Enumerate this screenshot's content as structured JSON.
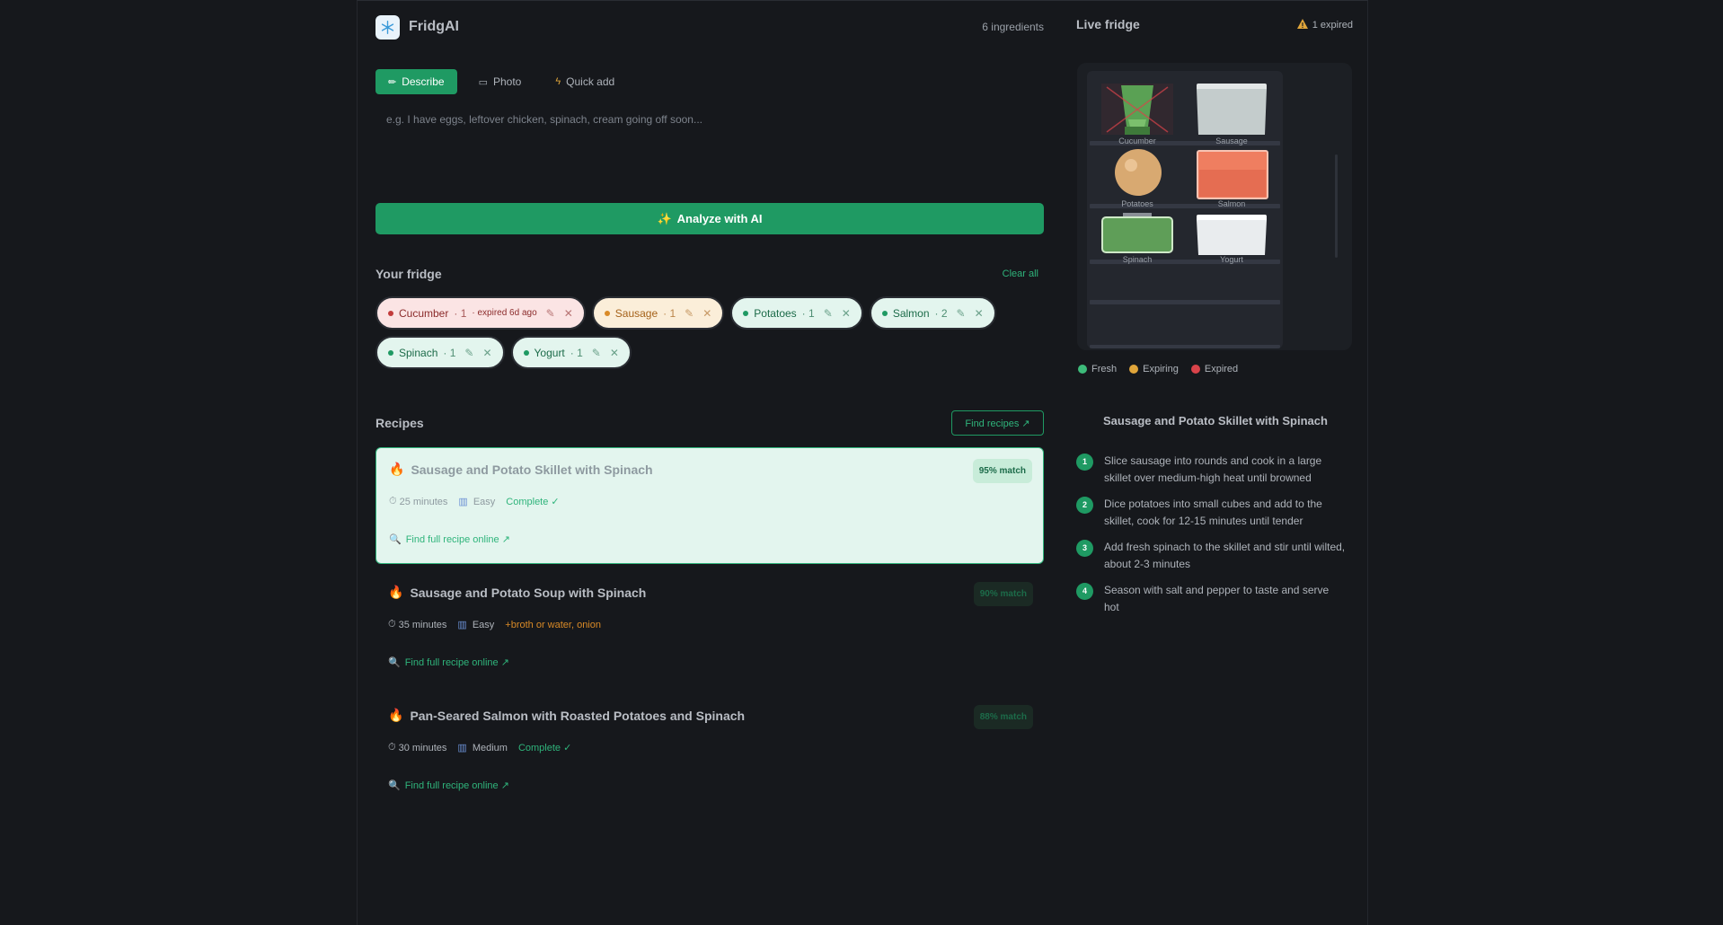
{
  "app": {
    "title": "FridgAI",
    "ingredient_count": "6 ingredients"
  },
  "input_tabs": [
    {
      "label": "Describe",
      "icon": "pencil-icon",
      "active": true
    },
    {
      "label": "Photo",
      "icon": "camera-icon",
      "active": false
    },
    {
      "label": "Quick add",
      "icon": "lightning-icon",
      "active": false
    }
  ],
  "describe": {
    "placeholder": "e.g. I have eggs, leftover chicken, spinach, cream going off soon...",
    "analyze_label": "Analyze with AI",
    "analyze_icon": "sparkles-icon"
  },
  "fridge_section": {
    "title": "Your fridge",
    "clear_label": "Clear all",
    "items": [
      {
        "name": "Cucumber",
        "qty": "· 1",
        "status": "expired",
        "note": "· expired 6d ago"
      },
      {
        "name": "Sausage",
        "qty": "· 1",
        "status": "expiring",
        "note": ""
      },
      {
        "name": "Potatoes",
        "qty": "· 1",
        "status": "fresh",
        "note": ""
      },
      {
        "name": "Salmon",
        "qty": "· 2",
        "status": "fresh",
        "note": ""
      },
      {
        "name": "Spinach",
        "qty": "· 1",
        "status": "fresh",
        "note": ""
      },
      {
        "name": "Yogurt",
        "qty": "· 1",
        "status": "fresh",
        "note": ""
      }
    ]
  },
  "recipes_section": {
    "title": "Recipes",
    "find_label": "Find recipes ↗",
    "recipes": [
      {
        "title": "Sausage and Potato Skillet with Spinach",
        "time": "25 minutes",
        "difficulty": "Easy",
        "status": "Complete ✓",
        "status_type": "complete",
        "match": "95% match",
        "link": "Find full recipe online ↗",
        "selected": true
      },
      {
        "title": "Sausage and Potato Soup with Spinach",
        "time": "35 minutes",
        "difficulty": "Easy",
        "status": "+broth or water, onion",
        "status_type": "missing",
        "match": "90% match",
        "link": "Find full recipe online ↗",
        "selected": false
      },
      {
        "title": "Pan-Seared Salmon with Roasted Potatoes and Spinach",
        "time": "30 minutes",
        "difficulty": "Medium",
        "status": "Complete ✓",
        "status_type": "complete",
        "match": "88% match",
        "link": "Find full recipe online ↗",
        "selected": false
      }
    ]
  },
  "live_fridge": {
    "title": "Live fridge",
    "expired_badge": "1 expired",
    "item_labels": [
      "Cucumber",
      "Sausage",
      "Potatoes",
      "Salmon",
      "Spinach",
      "Yogurt"
    ],
    "legend": [
      {
        "label": "Fresh",
        "color": "#3dbb7a"
      },
      {
        "label": "Expiring",
        "color": "#e0a53a"
      },
      {
        "label": "Expired",
        "color": "#d9434a"
      }
    ]
  },
  "selected_recipe": {
    "title": "Sausage and Potato Skillet with Spinach",
    "steps": [
      "Slice sausage into rounds and cook in a large skillet over medium-high heat until browned",
      "Dice potatoes into small cubes and add to the skillet, cook for 12-15 minutes until tender",
      "Add fresh spinach to the skillet and stir until wilted, about 2-3 minutes",
      "Season with salt and pepper to taste and serve hot"
    ]
  },
  "colors": {
    "accent": "#1f9a63",
    "background": "#16181c"
  }
}
